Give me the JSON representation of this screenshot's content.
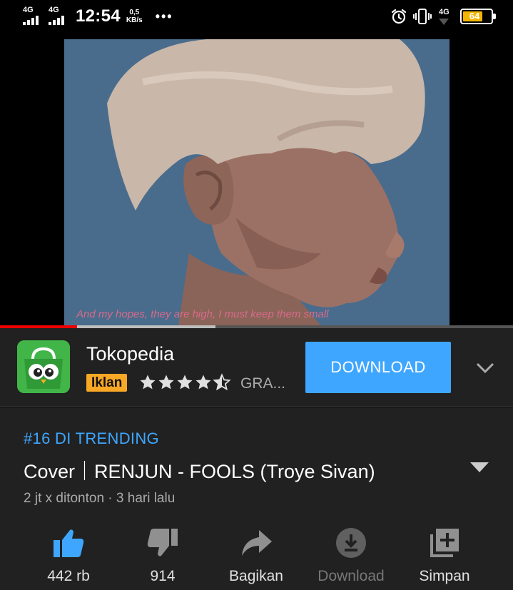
{
  "status_bar": {
    "sim1": "4G",
    "sim2": "4G",
    "time": "12:54",
    "speed_value": "0,5",
    "speed_unit": "KB/s",
    "more": "•••",
    "network": "4G",
    "battery": "64",
    "battery_level": 0.64,
    "battery_color": "#f4b400"
  },
  "video": {
    "subtitle": "And my hopes, they are high, I must keep them small",
    "progress_played": 0.15,
    "progress_buffered": 0.42
  },
  "ad": {
    "app_name": "Tokopedia",
    "badge": "Iklan",
    "rating": 4.5,
    "extra": "GRA...",
    "button": "DOWNLOAD",
    "accent": "#3ea6ff"
  },
  "info": {
    "trending": "#16 DI TRENDING",
    "title": "Cover｜RENJUN - FOOLS (Troye Sivan)",
    "meta": "2 jt x ditonton · 3 hari lalu",
    "actions": [
      {
        "icon": "thumb-up-icon",
        "label": "442 rb",
        "color": "#3ea6ff"
      },
      {
        "icon": "thumb-down-icon",
        "label": "914",
        "color": "#909090"
      },
      {
        "icon": "share-icon",
        "label": "Bagikan",
        "color": "#909090"
      },
      {
        "icon": "download-icon",
        "label": "Download",
        "color": "#606060"
      },
      {
        "icon": "add-to-playlist-icon",
        "label": "Simpan",
        "color": "#909090"
      }
    ]
  }
}
